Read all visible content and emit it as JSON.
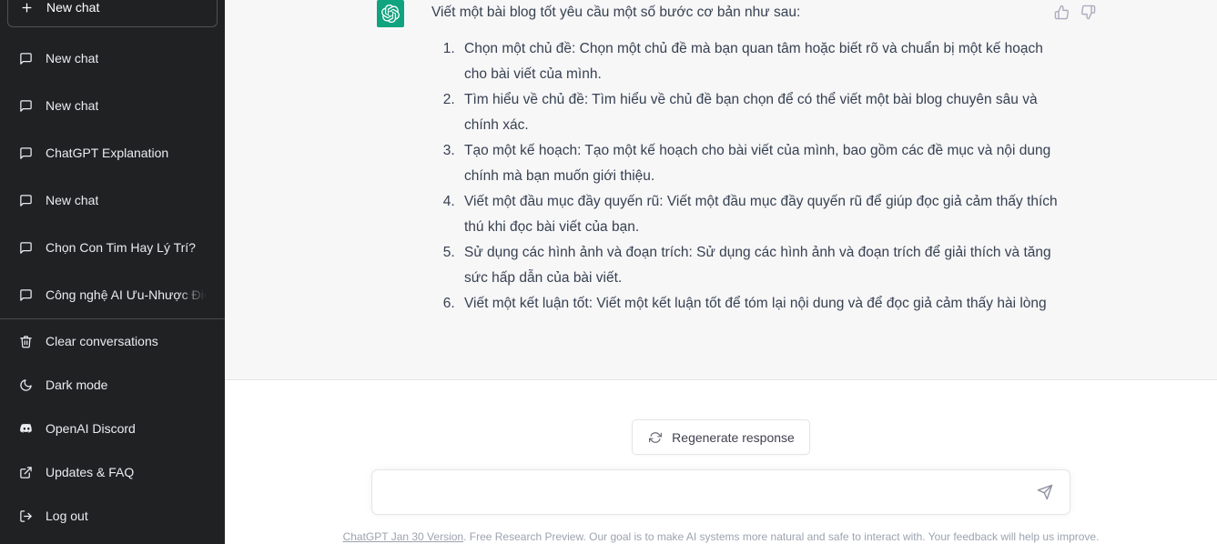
{
  "sidebar": {
    "new_chat_label": "New chat",
    "new_chat_icon": "plus-icon",
    "conversations": [
      {
        "label": "New chat",
        "icon": "chat-bubble-icon"
      },
      {
        "label": "New chat",
        "icon": "chat-bubble-icon"
      },
      {
        "label": "ChatGPT Explanation",
        "icon": "chat-bubble-icon"
      },
      {
        "label": "New chat",
        "icon": "chat-bubble-icon"
      },
      {
        "label": "Chọn Con Tim Hay Lý Trí?",
        "icon": "chat-bubble-icon"
      },
      {
        "label": "Công nghệ AI Ưu-Nhược Điểm",
        "icon": "chat-bubble-icon"
      }
    ],
    "menu": [
      {
        "label": "Clear conversations",
        "icon": "trash-icon"
      },
      {
        "label": "Dark mode",
        "icon": "moon-icon"
      },
      {
        "label": "OpenAI Discord",
        "icon": "discord-icon"
      },
      {
        "label": "Updates & FAQ",
        "icon": "external-link-icon"
      },
      {
        "label": "Log out",
        "icon": "logout-icon"
      }
    ],
    "background_color": "#202123"
  },
  "message": {
    "avatar_icon": "chatgpt-logo-icon",
    "avatar_color": "#10a37f",
    "intro": "Viết một bài blog tốt yêu cầu một số bước cơ bản như sau:",
    "steps": [
      "Chọn một chủ đề: Chọn một chủ đề mà bạn quan tâm hoặc biết rõ và chuẩn bị một kế hoạch cho bài viết của mình.",
      "Tìm hiểu về chủ đề: Tìm hiểu về chủ đề bạn chọn để có thể viết một bài blog chuyên sâu và chính xác.",
      "Tạo một kế hoạch: Tạo một kế hoạch cho bài viết của mình, bao gồm các đề mục và nội dung chính mà bạn muốn giới thiệu.",
      "Viết một đầu mục đầy quyến rũ: Viết một đầu mục đầy quyến rũ để giúp đọc giả cảm thấy thích thú khi đọc bài viết của bạn.",
      "Sử dụng các hình ảnh và đoạn trích: Sử dụng các hình ảnh và đoạn trích để giải thích và tăng sức hấp dẫn của bài viết.",
      "Viết một kết luận tốt: Viết một kết luận tốt để tóm lại nội dung và để đọc giả cảm thấy hài lòng"
    ],
    "thumbs_up_icon": "thumbs-up-icon",
    "thumbs_down_icon": "thumbs-down-icon",
    "background_color": "#f7f7f8"
  },
  "composer": {
    "regenerate_label": "Regenerate response",
    "regenerate_icon": "refresh-icon",
    "input_value": "",
    "input_placeholder": "",
    "send_icon": "send-paper-plane-icon"
  },
  "footer": {
    "link_label": "ChatGPT Jan 30 Version",
    "text": ". Free Research Preview. Our goal is to make AI systems more natural and safe to interact with. Your feedback will help us improve."
  }
}
